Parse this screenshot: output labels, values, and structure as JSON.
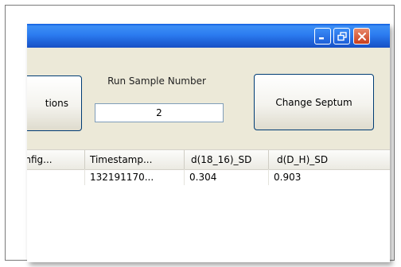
{
  "titlebar": {
    "minimize_icon": "minimize-icon",
    "restore_icon": "restore-icon",
    "close_icon": "close-icon"
  },
  "toolbar": {
    "options_label": "tions",
    "run_sample_label": "Run Sample Number",
    "run_sample_value": "2",
    "change_septum_label": "Change Septum"
  },
  "grid": {
    "columns": [
      "onfig...",
      "Timestamp...",
      "d(18_16)_SD",
      "d(D_H)_SD"
    ],
    "rows": [
      [
        "",
        "132191170...",
        "0.304",
        "0.903"
      ]
    ]
  },
  "colors": {
    "titlebar": "#2c7cf0",
    "close_button": "#c93e1c",
    "window_background": "#ece9d8"
  }
}
